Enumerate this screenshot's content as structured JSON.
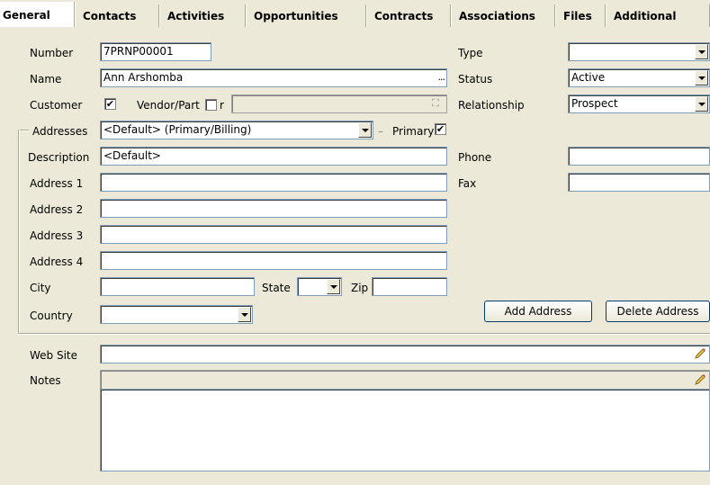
{
  "tabs": [
    {
      "label": "General",
      "active": true
    },
    {
      "label": "Contacts"
    },
    {
      "label": "Activities"
    },
    {
      "label": "Opportunities"
    },
    {
      "label": "Contracts"
    },
    {
      "label": "Associations"
    },
    {
      "label": "Files"
    },
    {
      "label": "Additional"
    }
  ],
  "form": {
    "number": {
      "label": "Number",
      "value": "7PRNP00001"
    },
    "name": {
      "label": "Name",
      "value": "Ann Arshomba",
      "browse": "..."
    },
    "customer": {
      "label": "Customer",
      "checked": true
    },
    "vendor": {
      "label": "Vendor/Part",
      "suffix": "r",
      "checked": false
    },
    "type": {
      "label": "Type",
      "value": ""
    },
    "status": {
      "label": "Status",
      "value": "Active"
    },
    "relationship": {
      "label": "Relationship",
      "value": "Prospect"
    },
    "addresses": {
      "label": "Addresses",
      "value": "<Default> (Primary/Billing)",
      "dash": "–",
      "primary_label": "Primary",
      "primary_checked": true
    },
    "description": {
      "label": "Description",
      "value": "<Default>"
    },
    "phone": {
      "label": "Phone",
      "value": ""
    },
    "fax": {
      "label": "Fax",
      "value": ""
    },
    "address1": {
      "label": "Address 1",
      "value": ""
    },
    "address2": {
      "label": "Address 2",
      "value": ""
    },
    "address3": {
      "label": "Address 3",
      "value": ""
    },
    "address4": {
      "label": "Address 4",
      "value": ""
    },
    "city": {
      "label": "City",
      "value": ""
    },
    "state": {
      "label": "State",
      "value": ""
    },
    "zip": {
      "label": "Zip",
      "value": ""
    },
    "country": {
      "label": "Country",
      "value": ""
    },
    "add_address": "Add Address",
    "delete_address": "Delete Address",
    "website": {
      "label": "Web Site",
      "value": ""
    },
    "notes": {
      "label": "Notes",
      "value": ""
    }
  },
  "glyphs": {
    "check": "✔",
    "binoculars": "⛶"
  },
  "colors": {
    "panel_bg": "#ece9d8",
    "field_border": "#7f9db9",
    "button_border": "#003c74"
  }
}
